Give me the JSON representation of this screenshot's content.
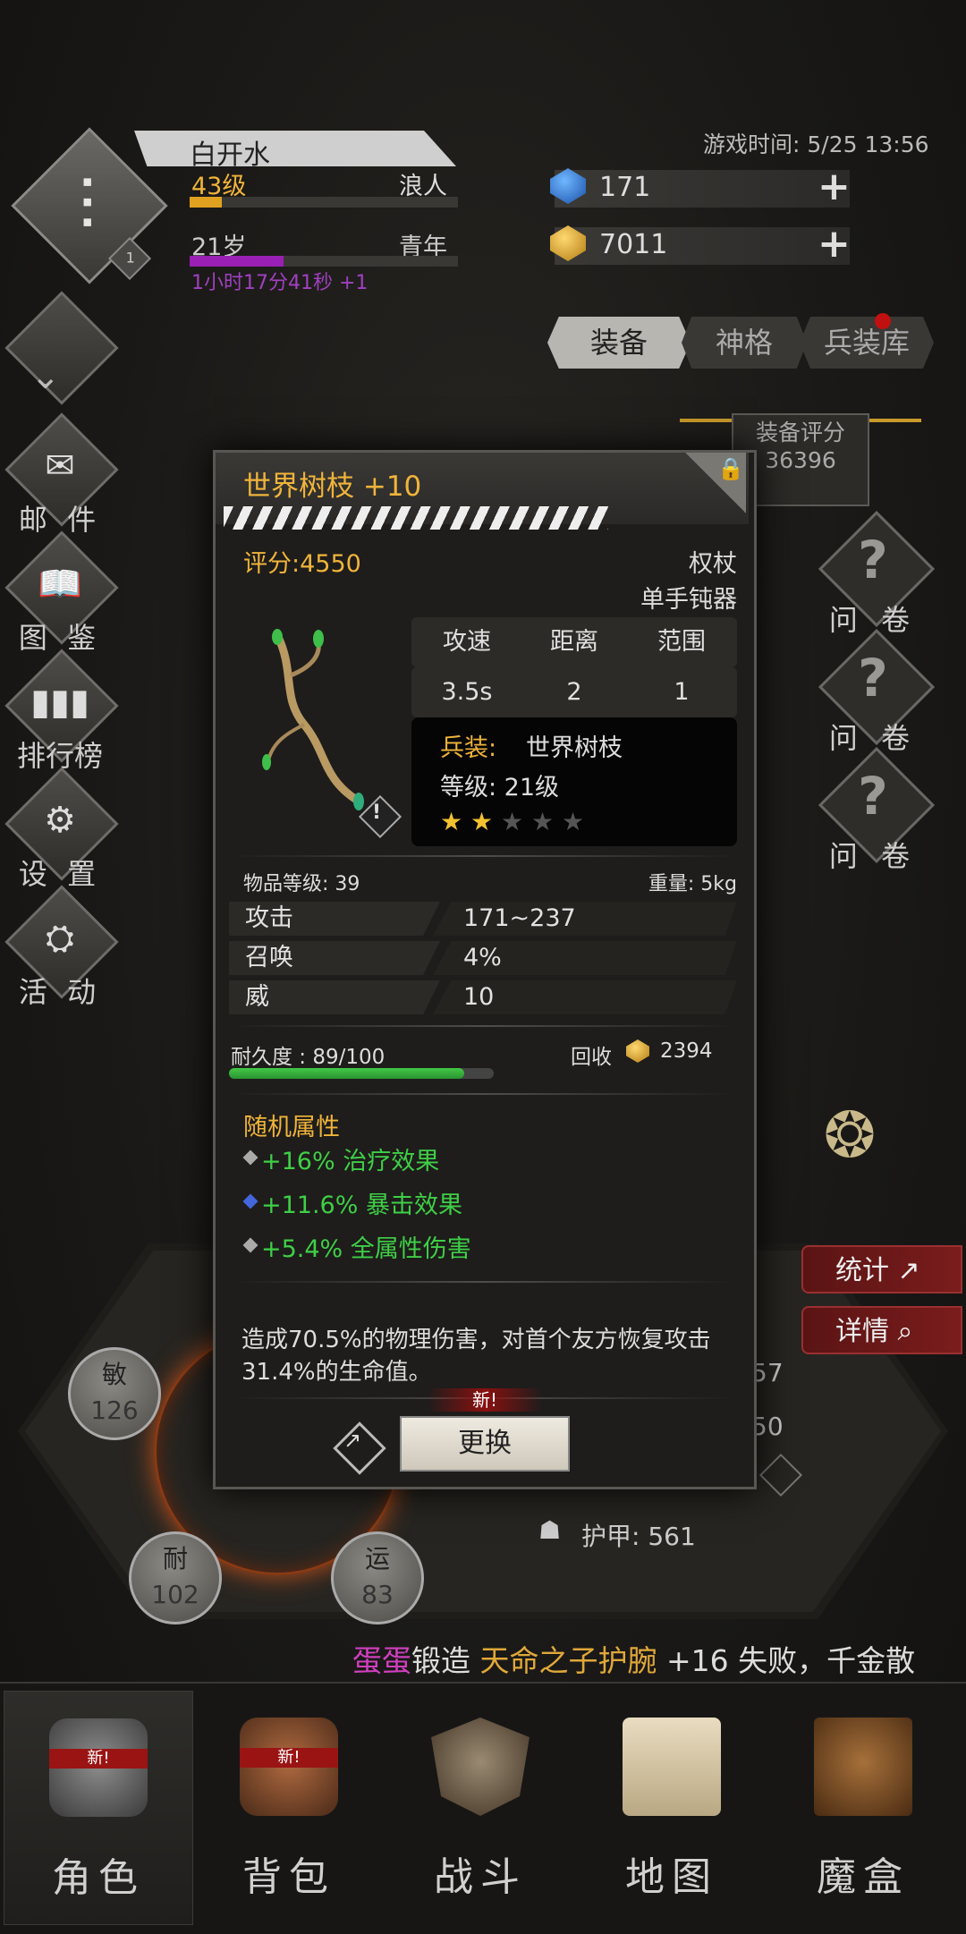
{
  "header": {
    "clock": "游戏时间: 5/25 13:56",
    "player_name": "白开水",
    "level": "43级",
    "class": "浪人",
    "age": "21岁",
    "age_stage": "青年",
    "timer": "1小时17分41秒 +1",
    "badge_level": "1",
    "level_progress": 0.12,
    "age_progress": 0.35
  },
  "currency": {
    "gems": "171",
    "gold": "7011"
  },
  "tabs": [
    {
      "label": "装备",
      "active": true
    },
    {
      "label": "神格",
      "active": false
    },
    {
      "label": "兵装库",
      "active": false
    }
  ],
  "sidebar": [
    {
      "label": "邮 件",
      "icon": "mail-icon"
    },
    {
      "label": "图 鉴",
      "icon": "book-icon"
    },
    {
      "label": "排行榜",
      "icon": "ranking-icon"
    },
    {
      "label": "设 置",
      "icon": "gear-icon"
    },
    {
      "label": "活 动",
      "icon": "anvil-icon"
    }
  ],
  "equip_score": {
    "label": "装备评分",
    "value": "36396"
  },
  "questionnaires": [
    "问 卷",
    "问 卷",
    "问 卷"
  ],
  "right_buttons": {
    "stats": "统计",
    "details": "详情"
  },
  "behind_stats": {
    "v1": "57",
    "v2": "50",
    "armor": "护甲: 561"
  },
  "attributes": [
    {
      "name": "敏",
      "value": "126"
    },
    {
      "name": "耐",
      "value": "102"
    },
    {
      "name": "运",
      "value": "83"
    }
  ],
  "item": {
    "title": "世界树枝 +10",
    "score": "评分:4550",
    "type": "权杖",
    "subtype": "单手钝器",
    "stat_headers": [
      "攻速",
      "距离",
      "范围"
    ],
    "stat_values": [
      "3.5s",
      "2",
      "1"
    ],
    "weapon_label": "兵装:",
    "weapon_name": "世界树枝",
    "weapon_level": "等级: 21级",
    "stars_filled": 2,
    "stars_total": 5,
    "item_level": "物品等级: 39",
    "weight": "重量: 5kg",
    "attrs": [
      {
        "name": "攻击",
        "value": "171~237"
      },
      {
        "name": "召唤",
        "value": "4%"
      },
      {
        "name": "威",
        "value": "10"
      }
    ],
    "durability": "耐久度 : 89/100",
    "durability_ratio": 0.89,
    "recycle_label": "回收",
    "recycle_value": "2394",
    "random_title": "随机属性",
    "random_attrs": [
      "+16% 治疗效果",
      "+11.6% 暴击效果",
      "+5.4% 全属性伤害"
    ],
    "description": "造成70.5%的物理伤害，对首个友方恢复攻击31.4%的生命值。",
    "new_tag": "新!",
    "swap_label": "更换"
  },
  "ticker": {
    "user": "蛋蛋",
    "action": "锻造 ",
    "item": "天命之子护腕",
    "rest": " +16 失败，千金散"
  },
  "nav": [
    {
      "label": "角色",
      "active": true,
      "new": true
    },
    {
      "label": "背包",
      "active": false,
      "new": true
    },
    {
      "label": "战斗",
      "active": false,
      "new": false
    },
    {
      "label": "地图",
      "active": false,
      "new": false
    },
    {
      "label": "魔盒",
      "active": false,
      "new": false
    }
  ],
  "nav_new_text": "新!",
  "colors": {
    "accent_gold": "#f0b43a",
    "green_attr": "#44d24b",
    "red_button": "#7a1c1c"
  }
}
